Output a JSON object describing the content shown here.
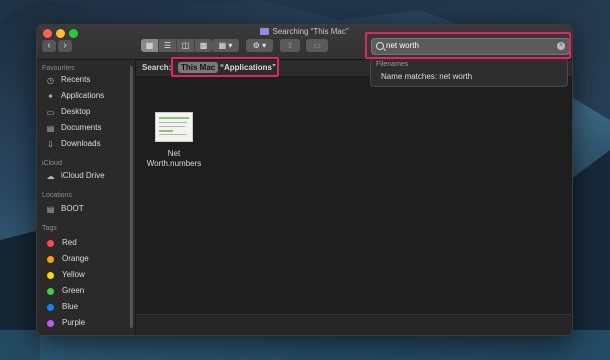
{
  "window": {
    "title": "Searching “This Mac”"
  },
  "toolbar": {
    "back_label": "‹",
    "forward_label": "›",
    "view_icons": [
      "grid-view-icon",
      "list-view-icon",
      "column-view-icon",
      "gallery-view-icon"
    ],
    "group_label": "▦ ▾",
    "action_label": "⚙ ▾"
  },
  "sidebar": {
    "favourites_header": "Favourites",
    "favourites": [
      {
        "label": "Recents",
        "icon": "clock-icon"
      },
      {
        "label": "Applications",
        "icon": "applications-icon"
      },
      {
        "label": "Desktop",
        "icon": "desktop-icon"
      },
      {
        "label": "Documents",
        "icon": "document-icon"
      },
      {
        "label": "Downloads",
        "icon": "download-icon"
      }
    ],
    "icloud_header": "iCloud",
    "icloud": [
      {
        "label": "iCloud Drive",
        "icon": "cloud-icon"
      }
    ],
    "locations_header": "Locations",
    "locations": [
      {
        "label": "BOOT",
        "icon": "disk-icon"
      }
    ],
    "tags_header": "Tags",
    "tags": [
      {
        "label": "Red",
        "color": "#ff4b47"
      },
      {
        "label": "Orange",
        "color": "#ff9f0a"
      },
      {
        "label": "Yellow",
        "color": "#ffd60a"
      },
      {
        "label": "Green",
        "color": "#32d74b"
      },
      {
        "label": "Blue",
        "color": "#0a84ff"
      },
      {
        "label": "Purple",
        "color": "#bf5af2"
      }
    ]
  },
  "scope": {
    "label": "Search:",
    "this_mac": "This Mac",
    "applications": "“Applications”"
  },
  "results": [
    {
      "name": "Net Worth.numbers"
    }
  ],
  "search": {
    "query": "net worth"
  },
  "suggestions": {
    "header": "Filenames",
    "item": "Name matches: net worth"
  },
  "colors": {
    "highlight": "#e5245c"
  }
}
